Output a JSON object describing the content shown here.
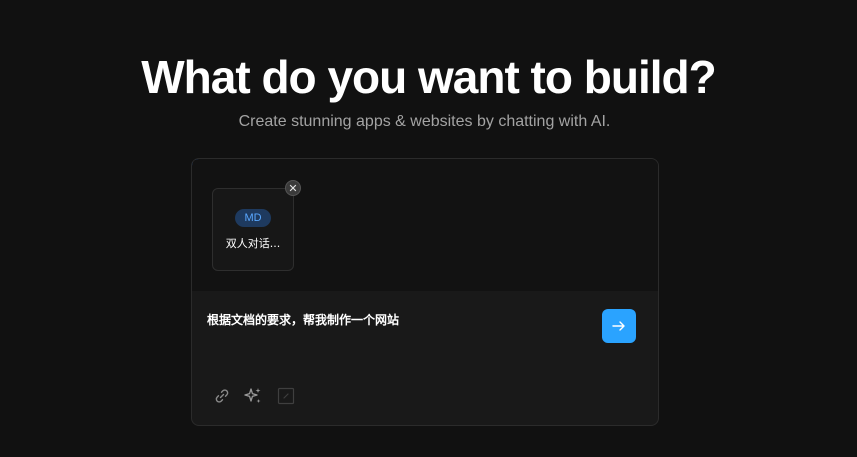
{
  "hero": {
    "title": "What do you want to build?",
    "subtitle": "Create stunning apps & websites by chatting with AI."
  },
  "attachments": [
    {
      "type_badge": "MD",
      "name": "双人对话...",
      "remove_icon": "close-icon"
    }
  ],
  "prompt": {
    "value": "根据文档的要求，帮我制作一个网站"
  },
  "toolbar": {
    "icons": [
      "link-icon",
      "sparkles-icon",
      "edit-icon"
    ]
  },
  "send_button": {
    "icon": "arrow-right-icon"
  },
  "colors": {
    "background": "#111111",
    "accent": "#2aa3ff",
    "badge_bg": "#1e3a5f",
    "badge_text": "#5aa8ff",
    "subtitle": "#a3a3a3"
  }
}
